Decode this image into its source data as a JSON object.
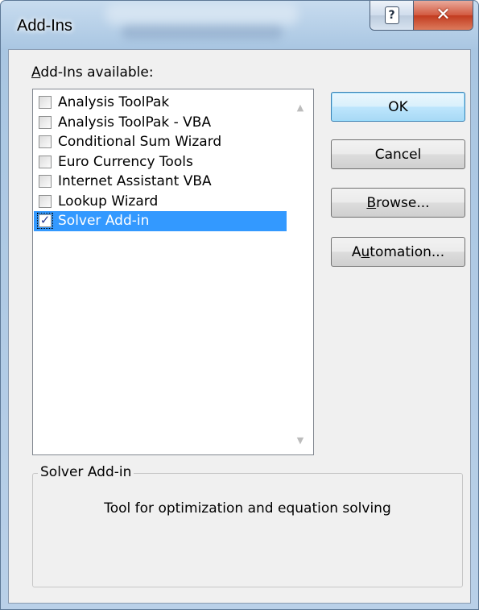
{
  "window": {
    "title": "Add-Ins"
  },
  "caption_buttons": {
    "help": "?",
    "close": "✕"
  },
  "list": {
    "label_accel": "A",
    "label_rest": "dd-Ins available:",
    "items": [
      {
        "label": "Analysis ToolPak",
        "checked": false,
        "selected": false
      },
      {
        "label": "Analysis ToolPak - VBA",
        "checked": false,
        "selected": false
      },
      {
        "label": "Conditional Sum Wizard",
        "checked": false,
        "selected": false
      },
      {
        "label": "Euro Currency Tools",
        "checked": false,
        "selected": false
      },
      {
        "label": "Internet Assistant VBA",
        "checked": false,
        "selected": false
      },
      {
        "label": "Lookup Wizard",
        "checked": false,
        "selected": false
      },
      {
        "label": "Solver Add-in",
        "checked": true,
        "selected": true
      }
    ]
  },
  "buttons": {
    "ok": "OK",
    "cancel": "Cancel",
    "browse_accel": "B",
    "browse_rest": "rowse...",
    "automation_pre": "A",
    "automation_accel": "u",
    "automation_rest": "tomation..."
  },
  "details": {
    "title": "Solver Add-in",
    "description": "Tool for optimization and equation solving"
  },
  "colors": {
    "selection": "#3399ff",
    "default_button": "#bee6fd",
    "close_button": "#c23b1f"
  },
  "icons": {
    "help": "help-icon",
    "close": "close-icon",
    "scroll_up": "scroll-up-arrow-icon",
    "scroll_down": "scroll-down-arrow-icon",
    "checkmark": "checkmark-icon"
  }
}
